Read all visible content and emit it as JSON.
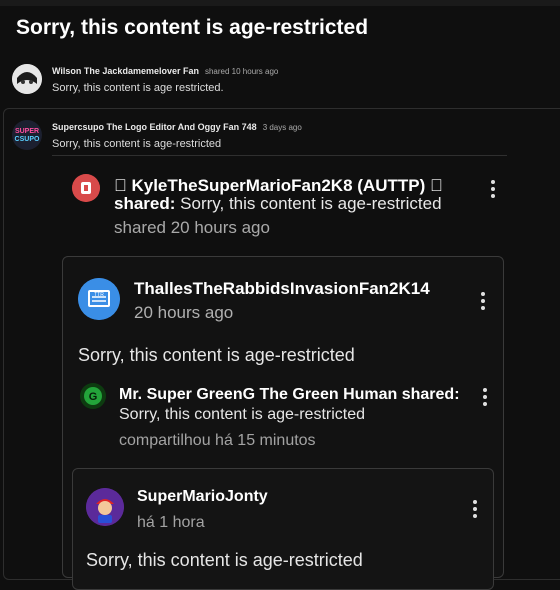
{
  "page": {
    "title": "Sorry, this content is age-restricted"
  },
  "posts": [
    {
      "author": "Wilson The Jackdamemelover Fan",
      "meta": "shared 10 hours ago",
      "body": "Sorry, this content is age restricted.",
      "avatar_icon": "anime-avatar-icon"
    },
    {
      "author": "Supercsupo The Logo Editor And Oggy Fan 748",
      "meta": "3 days ago",
      "body": "Sorry, this content is age-restricted",
      "avatar_icon": "logo-avatar-icon"
    }
  ],
  "share_kyle": {
    "name": " KyleTheSuperMarioFan2K8 (AUTTP) ",
    "shared_label": "shared:",
    "body": " Sorry, this content is age-restricted",
    "time": "shared 20 hours ago",
    "avatar_icon": "red-avatar-icon"
  },
  "card_thalles": {
    "name": "ThallesTheRabbidsInvasionFan2K14",
    "time": "20 hours ago",
    "body": "Sorry, this content is age-restricted",
    "avatar_icon": "tv-avatar-icon",
    "avatar_color": "#3a8ee6"
  },
  "share_green": {
    "name": "Mr. Super GreenG The Green Human shared:",
    "body": "Sorry, this content is age-restricted",
    "time": "compartilhou há 15 minutos",
    "avatar_icon": "green-g-avatar-icon"
  },
  "card_jonty": {
    "name": "SuperMarioJonty",
    "time": "há 1 hora",
    "body": "Sorry, this content is age-restricted",
    "avatar_icon": "mario-avatar-icon"
  }
}
